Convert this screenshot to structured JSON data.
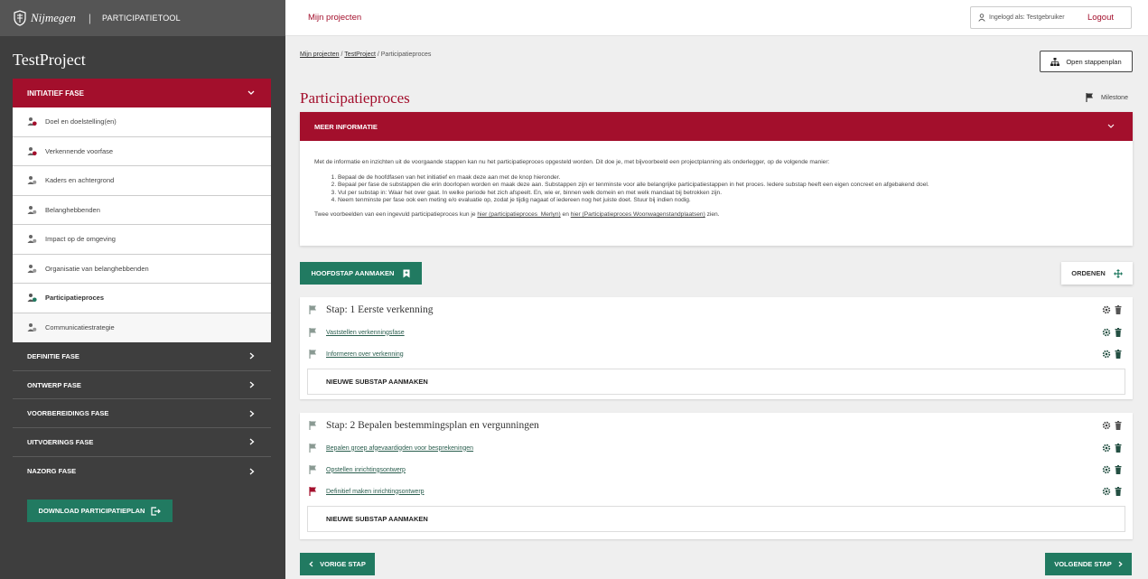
{
  "brand": {
    "logo_text": "Nijmegen",
    "separator": "|",
    "tool_name": "PARTICIPATIETOOL"
  },
  "topbar": {
    "nav_link": "Mijn projecten",
    "user_label": "Ingelogd als: Testgebruiker",
    "logout": "Logout"
  },
  "sidebar": {
    "project_title": "TestProject",
    "open_phase": "INITIATIEF FASE",
    "steps": [
      {
        "label": "Doel en doelstelling(en)",
        "status": "red"
      },
      {
        "label": "Verkennende voorfase",
        "status": "red"
      },
      {
        "label": "Kaders en achtergrond",
        "status": "grey"
      },
      {
        "label": "Belanghebbenden",
        "status": "grey"
      },
      {
        "label": "Impact op de omgeving",
        "status": "grey"
      },
      {
        "label": "Organisatie van belanghebbenden",
        "status": "grey"
      },
      {
        "label": "Participatieproces",
        "status": "green"
      },
      {
        "label": "Communicatiestrategie",
        "status": "grey"
      }
    ],
    "phases": [
      "DEFINITIE FASE",
      "ONTWERP FASE",
      "VOORBEREIDINGS FASE",
      "UITVOERINGS FASE",
      "NAZORG FASE"
    ],
    "download_label": "DOWNLOAD PARTICIPATIEPLAN"
  },
  "breadcrumb": {
    "item1": "Mijn projecten",
    "sep1": " / ",
    "item2": "TestProject",
    "sep2": " / ",
    "current": "Participatieproces"
  },
  "open_stappenplan": "Open stappenplan",
  "page_title": "Participatieproces",
  "milestone_label": "Milestone",
  "info": {
    "header": "MEER INFORMATIE",
    "intro": "Met de informatie en inzichten uit de voorgaande stappen kan nu het participatieproces opgesteld worden. Dit doe je, met bijvoorbeeld een projectplanning als onderlegger, op de volgende manier:",
    "items": [
      "Bepaal de de hoofdfasen van het initiatief en maak deze aan met de knop hieronder.",
      "Bepaal per fase de substappen die erin doorlopen worden en maak deze aan. Substappen zijn er tenminste voor alle belangrijke participatiestappen in het proces. Iedere substap heeft een eigen concreet en afgebakend doel.",
      "Vul per substap in: Waar het over gaat. In welke periode het zich afspeelt. En, wie er, binnen welk domein en met welk mandaat bij betrokken zijn.",
      "Neem tenminste per fase ook een meting e/o evaluatie op, zodat je tijdig nagaat of iedereen nog het juiste doet. Stuur bij indien nodig."
    ],
    "examples_prefix": "Twee voorbeelden van een ingevuld participatieproces kun je ",
    "link1": "hier (participatieproces_Merlyn)",
    "examples_mid": " en ",
    "link2": "hier (Participatieproces Woonwagenstandplaatsen)",
    "examples_suffix": " zien."
  },
  "hoofdstap_button": "HOOFDSTAP AANMAKEN",
  "ordenen_button": "ORDENEN",
  "stages": [
    {
      "title": "Stap: 1 Eerste verkenning",
      "substeps": [
        {
          "label": "Vaststellen verkenningsfase",
          "flag": "grey"
        },
        {
          "label": "Informeren over verkenning",
          "flag": "grey"
        }
      ],
      "new_sub": "NIEUWE SUBSTAP AANMAKEN"
    },
    {
      "title": "Stap: 2 Bepalen bestemmingsplan en vergunningen",
      "substeps": [
        {
          "label": "Bepalen groep afgevaardigden voor besprekeningen",
          "flag": "grey"
        },
        {
          "label": "Opstellen inrichtingsontwerp",
          "flag": "grey"
        },
        {
          "label": "Definitief maken inrichtingsontwerp",
          "flag": "red"
        }
      ],
      "new_sub": "NIEUWE SUBSTAP AANMAKEN"
    }
  ],
  "prev_button": "VORIGE STAP",
  "next_button": "VOLGENDE STAP",
  "colors": {
    "brand_red": "#a30f2c",
    "action_green": "#217a61",
    "sidebar_dark": "#3e3e3e"
  }
}
